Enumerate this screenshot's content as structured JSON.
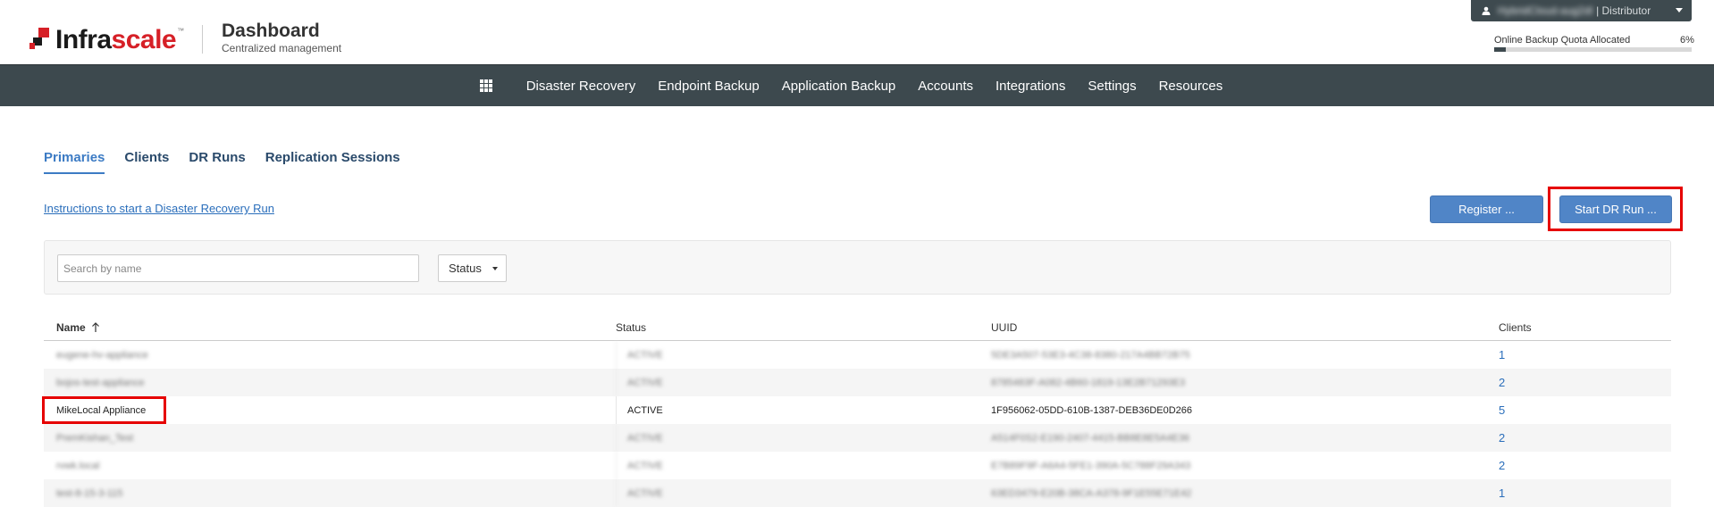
{
  "header": {
    "logo_text_a": "Infra",
    "logo_text_b": "scale",
    "logo_tm": "™",
    "title": "Dashboard",
    "subtitle": "Centralized management",
    "user": {
      "name": "HybridCloud-aug2dl",
      "role": "| Distributor"
    },
    "quota": {
      "label": "Online Backup Quota Allocated",
      "value_text": "6%",
      "fraction": 0.06
    }
  },
  "nav": {
    "items": [
      "Disaster Recovery",
      "Endpoint Backup",
      "Application Backup",
      "Accounts",
      "Integrations",
      "Settings",
      "Resources"
    ]
  },
  "tabs": [
    {
      "label": "Primaries",
      "active": true
    },
    {
      "label": "Clients",
      "active": false
    },
    {
      "label": "DR Runs",
      "active": false
    },
    {
      "label": "Replication Sessions",
      "active": false
    }
  ],
  "instructions_link": "Instructions to start a Disaster Recovery Run",
  "buttons": {
    "register": "Register ...",
    "start_dr": "Start DR Run ..."
  },
  "filter": {
    "search_placeholder": "Search by name",
    "status_label": "Status"
  },
  "table": {
    "columns": [
      "Name",
      "Status",
      "UUID",
      "Clients"
    ],
    "rows": [
      {
        "name": "eugene-hv-appliance",
        "status": "ACTIVE",
        "uuid": "5DE3A507-53E3-4C38-8380-217A4BB72B75",
        "clients": "1",
        "blurred": true
      },
      {
        "name": "bojos-test-appliance",
        "status": "ACTIVE",
        "uuid": "8785483F-A082-4B60-1819-13E2B71293E3",
        "clients": "2",
        "blurred": true
      },
      {
        "name": "MikeLocal Appliance",
        "status": "ACTIVE",
        "uuid": "1F956062-05DD-610B-1387-DEB36DE0D266",
        "clients": "5",
        "blurred": false
      },
      {
        "name": "PremKishan_Test",
        "status": "ACTIVE",
        "uuid": "A514F0S2-E190-2407-4415-BB8E8E5A4E36",
        "clients": "2",
        "blurred": true
      },
      {
        "name": "rvwk.local",
        "status": "ACTIVE",
        "uuid": "E7B89F9F-A6A4-5FE1-390A-5C788F29A343",
        "clients": "2",
        "blurred": true
      },
      {
        "name": "test-8-15-3-115",
        "status": "ACTIVE",
        "uuid": "63ED3479-E20B-38CA-A378-9F1E55E71E42",
        "clients": "1",
        "blurred": true
      }
    ]
  }
}
